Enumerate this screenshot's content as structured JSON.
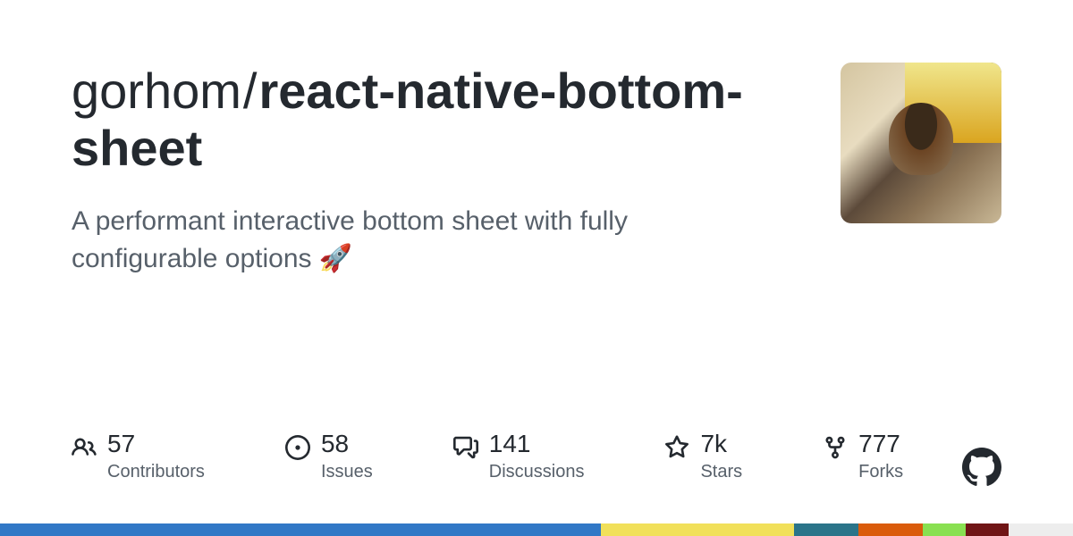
{
  "repo": {
    "owner": "gorhom",
    "name": "react-native-bottom-sheet",
    "description": "A performant interactive bottom sheet with fully configurable options 🚀"
  },
  "stats": {
    "contributors": {
      "value": "57",
      "label": "Contributors"
    },
    "issues": {
      "value": "58",
      "label": "Issues"
    },
    "discussions": {
      "value": "141",
      "label": "Discussions"
    },
    "stars": {
      "value": "7k",
      "label": "Stars"
    },
    "forks": {
      "value": "777",
      "label": "Forks"
    }
  },
  "colors": {
    "bar": [
      {
        "color": "#3178c6",
        "pct": 56
      },
      {
        "color": "#f1e05a",
        "pct": 18
      },
      {
        "color": "#2b7489",
        "pct": 6
      },
      {
        "color": "#DA5B0B",
        "pct": 6
      },
      {
        "color": "#89e051",
        "pct": 4
      },
      {
        "color": "#701516",
        "pct": 4
      },
      {
        "color": "#ededed",
        "pct": 6
      }
    ]
  }
}
